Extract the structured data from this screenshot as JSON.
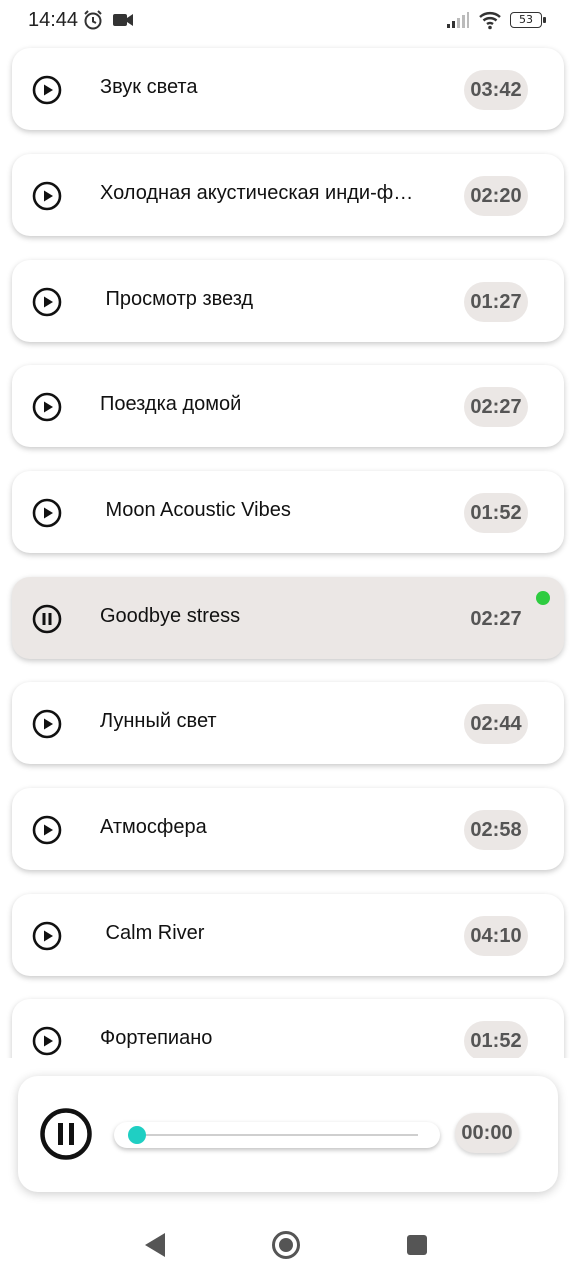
{
  "status_bar": {
    "time": "14:44",
    "battery": "53",
    "icons": [
      "alarm-icon",
      "video-camera-icon",
      "signal-icon",
      "wifi-icon",
      "battery-icon"
    ]
  },
  "tracks": [
    {
      "title": "Звук света",
      "duration": "03:42",
      "state": "play"
    },
    {
      "title": "Холодная акустическая инди-ф…",
      "duration": "02:20",
      "state": "play"
    },
    {
      "title": " Просмотр звезд",
      "duration": "01:27",
      "state": "play"
    },
    {
      "title": "Поездка домой",
      "duration": "02:27",
      "state": "play"
    },
    {
      "title": " Moon Acoustic Vibes",
      "duration": "01:52",
      "state": "play"
    },
    {
      "title": "Goodbye stress",
      "duration": "02:27",
      "state": "playing"
    },
    {
      "title": "Лунный свет",
      "duration": "02:44",
      "state": "play"
    },
    {
      "title": "Атмосфера",
      "duration": "02:58",
      "state": "play"
    },
    {
      "title": " Calm River",
      "duration": "04:10",
      "state": "play"
    },
    {
      "title": "Фортепиано",
      "duration": "01:52",
      "state": "play"
    }
  ],
  "player": {
    "elapsed": "00:00",
    "progress": 0,
    "button_icon": "pause-icon"
  },
  "colors": {
    "accent": "#1fcfc3",
    "playing_indicator": "#2ecc40",
    "active_card": "#ebe7e5",
    "duration_pill": "#ebe7e5"
  },
  "nav_bar": {
    "icons": [
      "back-icon",
      "home-icon",
      "recents-icon"
    ]
  }
}
